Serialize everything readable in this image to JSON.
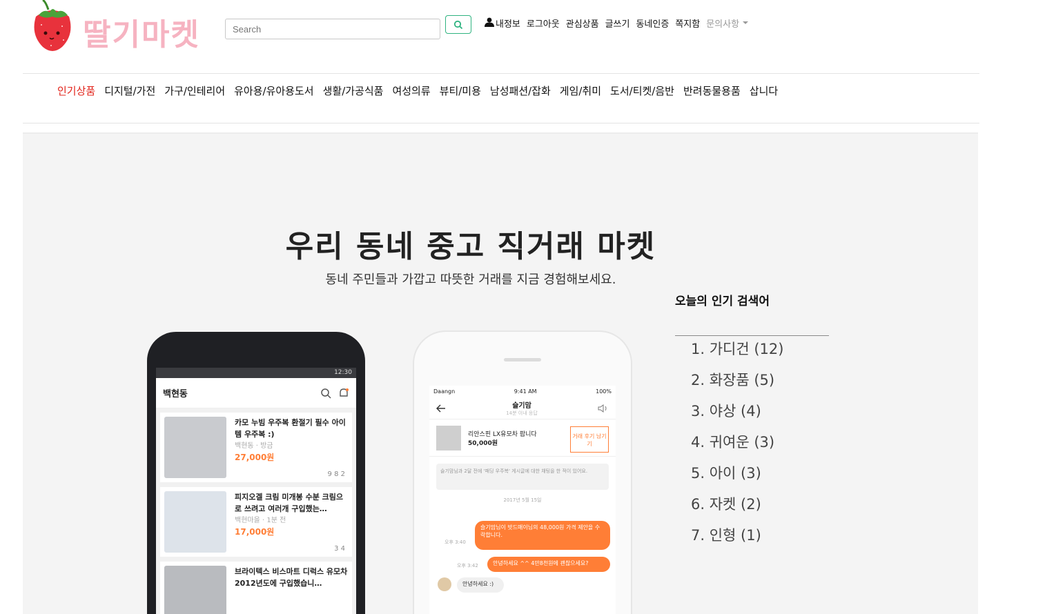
{
  "brand": {
    "name": "딸기마켓",
    "accent": "#f6b3c1"
  },
  "search": {
    "placeholder": "Search",
    "button_icon": "search-icon"
  },
  "top_links": {
    "my_info": "내정보",
    "logout": "로그아웃",
    "interests": "관심상품",
    "write": "글쓰기",
    "neighborhood_auth": "동네인증",
    "messages": "쪽지함",
    "inquiry": "문의사항"
  },
  "categories": [
    "인기상품",
    "디지털/가전",
    "가구/인테리어",
    "유아용/유아용도서",
    "생활/가공식품",
    "여성의류",
    "뷰티/미용",
    "남성패션/잡화",
    "게임/취미",
    "도서/티켓/음반",
    "반려동물용품",
    "삽니다"
  ],
  "hero": {
    "title": "우리 동네 중고 직거래 마켓",
    "subtitle": "동네 주민들과 가깝고 따뜻한 거래를 지금 경험해보세요."
  },
  "phone_left": {
    "status_time": "12:30",
    "location": "백현동",
    "items": [
      {
        "title": "카모 누빔 우주복 환절기 필수 아이템 우주복 :)",
        "meta": "백현동 · 방금",
        "price": "27,000원",
        "stats": "9  8  2"
      },
      {
        "title": "피지오겔 크림 미개봉 수분 크림으로 쓰려고 여러개 구입했는…",
        "meta": "백현마을 · 1분 전",
        "price": "17,000원",
        "stats": "3  4"
      },
      {
        "title": "브라이텍스 비스마트 디럭스 유모차 2012년도에 구입했습니…",
        "meta": "",
        "price": "",
        "stats": ""
      }
    ]
  },
  "phone_right": {
    "carrier": "Daangn",
    "time": "9:41 AM",
    "battery": "100%",
    "chat_name": "슬기맘",
    "chat_sub": "14분 이내 응답",
    "product_title": "리안스핀 LX유모차 팝니다",
    "product_price": "50,000원",
    "review_button": "거래 후기 남기기",
    "note": "슬기맘님과 2달 전에 '패딩 우주복' 게시글에 대한 채팅을 한 적이 있어요.",
    "date": "2017년 5월 15일",
    "msg1": "슬기맘님이 밧드매이님의 48,000원 가격 제안을 수락합니다.",
    "msg1_time": "오후 3:40",
    "msg2": "안녕하세요 ^^ 4만8천원에 괜찮으세요?",
    "msg2_time": "오후 3:42",
    "msg3": "안녕하세요 :)"
  },
  "popular": {
    "title": "오늘의 인기 검색어",
    "items": [
      "1. 가디건 (12)",
      "2. 화장품 (5)",
      "3. 야상 (4)",
      "4. 귀여운 (3)",
      "5. 아이 (3)",
      "6. 자켓 (2)",
      "7. 인형 (1)"
    ]
  },
  "colors": {
    "active_category": "#e2231a",
    "search_button": "#2fb380",
    "daangn_orange": "#ff7e36"
  }
}
